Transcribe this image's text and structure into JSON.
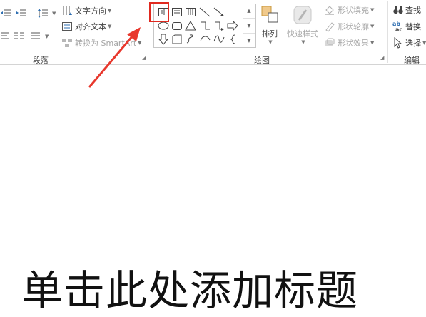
{
  "paragraph_group": {
    "label": "段落",
    "text_direction": "文字方向",
    "align_text": "对齐文本",
    "convert_smartart": "转换为 SmartArt"
  },
  "drawing_group": {
    "label": "绘图",
    "arrange": "排列",
    "quick_styles": "快速样式",
    "shape_fill": "形状填充",
    "shape_outline": "形状轮廓",
    "shape_effects": "形状效果"
  },
  "editing_group": {
    "label": "编辑",
    "find": "查找",
    "replace": "替换",
    "select": "选择"
  },
  "slide": {
    "title_placeholder": "单击此处添加标题"
  },
  "colors": {
    "highlight": "#e0291f",
    "arrow": "#e8382d"
  }
}
